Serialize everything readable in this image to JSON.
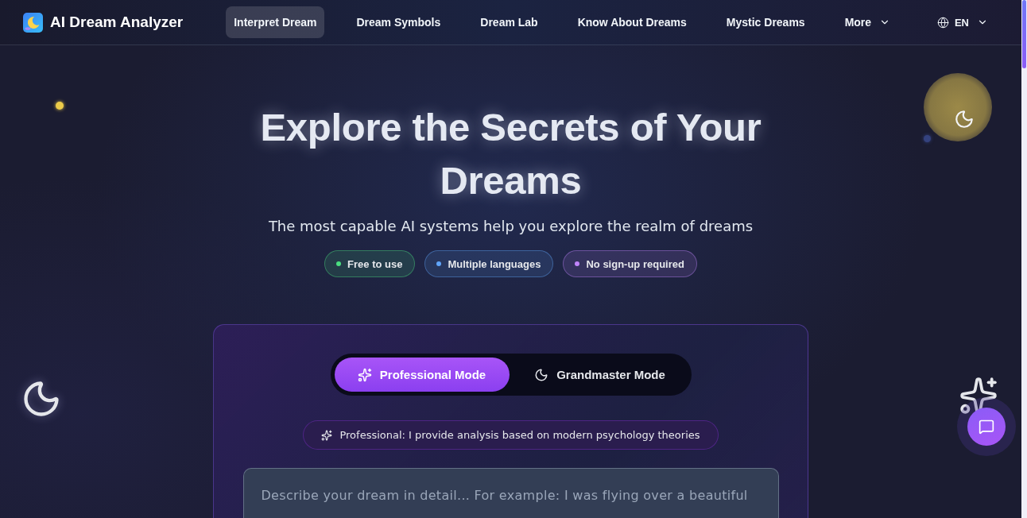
{
  "header": {
    "brand": "AI Dream Analyzer",
    "nav": [
      {
        "label": "Interpret Dream",
        "selected": true,
        "kind": "link"
      },
      {
        "label": "Dream Symbols",
        "selected": false,
        "kind": "link"
      },
      {
        "label": "Dream Lab",
        "selected": false,
        "kind": "link"
      },
      {
        "label": "Know About Dreams",
        "selected": false,
        "kind": "link"
      },
      {
        "label": "Mystic Dreams",
        "selected": false,
        "kind": "link"
      },
      {
        "label": "More",
        "selected": false,
        "kind": "dropdown"
      }
    ],
    "language": "EN"
  },
  "hero": {
    "title": "Explore the Secrets of Your Dreams",
    "subtitle": "The most capable AI systems help you explore the realm of dreams",
    "badges": [
      {
        "label": "Free to use",
        "color": "#4ade80"
      },
      {
        "label": "Multiple languages",
        "color": "#60a5fa"
      },
      {
        "label": "No sign-up required",
        "color": "#c084fc"
      }
    ]
  },
  "card": {
    "modes": [
      {
        "label": "Professional Mode",
        "selected": true,
        "kind": "sparkles"
      },
      {
        "label": "Grandmaster Mode",
        "selected": false,
        "kind": "moon"
      }
    ],
    "mode_note": "Professional: I provide analysis based on modern psychology theories",
    "dream_input": {
      "placeholder": "Describe your dream in detail... For example: I was flying over a beautiful"
    }
  }
}
